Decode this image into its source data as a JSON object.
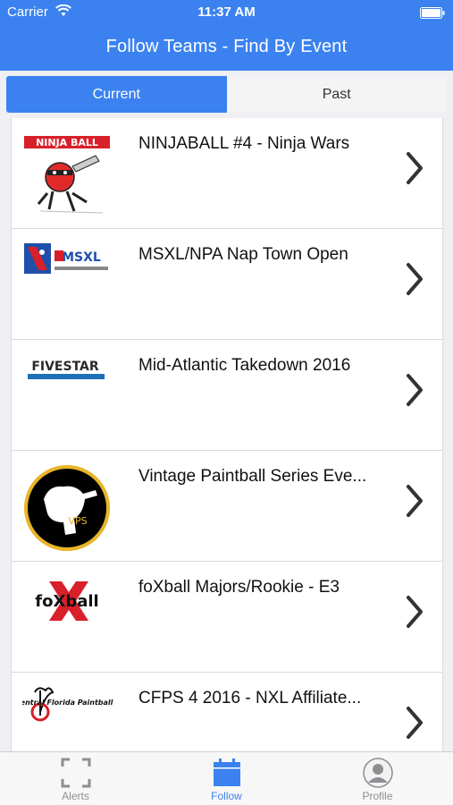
{
  "status_bar": {
    "carrier": "Carrier",
    "time": "11:37 AM"
  },
  "nav": {
    "title": "Follow Teams - Find By Event"
  },
  "segments": [
    {
      "label": "Current",
      "active": true
    },
    {
      "label": "Past",
      "active": false
    }
  ],
  "events": [
    {
      "title": "NINJABALL #4 - Ninja Wars",
      "logo": "ninjaball-logo",
      "logo_text": "NINJA BALL"
    },
    {
      "title": "MSXL/NPA Nap Town Open",
      "logo": "msxl-logo",
      "logo_text": "MSXL"
    },
    {
      "title": "Mid-Atlantic Takedown 2016",
      "logo": "fivestar-logo",
      "logo_text": "FIVESTAR"
    },
    {
      "title": "Vintage Paintball Series Eve...",
      "logo": "vps-logo",
      "logo_text": "VPS"
    },
    {
      "title": "foXball Majors/Rookie - E3",
      "logo": "foxball-logo",
      "logo_text": "foXball"
    },
    {
      "title": "CFPS 4 2016 - NXL Affiliate...",
      "logo": "cfps-logo",
      "logo_text": "Central Florida Paintball Series"
    }
  ],
  "tabbar": [
    {
      "label": "Alerts",
      "icon": "scan-frame-icon",
      "active": false
    },
    {
      "label": "Follow",
      "icon": "calendar-icon",
      "active": true
    },
    {
      "label": "Profile",
      "icon": "person-icon",
      "active": false
    }
  ],
  "colors": {
    "accent": "#3b82f0"
  }
}
